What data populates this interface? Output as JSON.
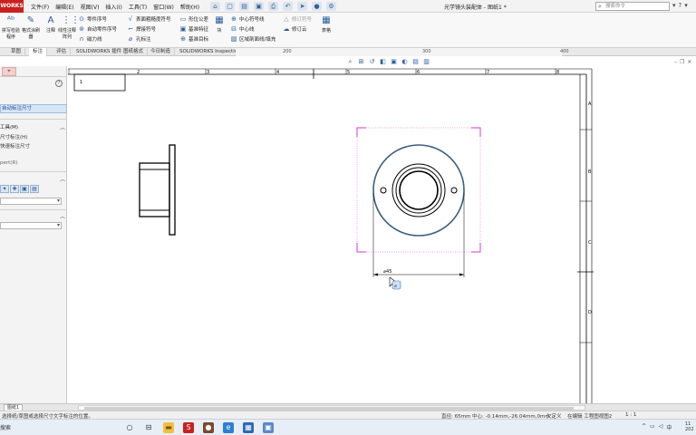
{
  "app": {
    "logo": "WORKS",
    "title": "光学镜头装配体 - 图纸1 *",
    "search_placeholder": "搜索命令"
  },
  "menus": [
    "文件(F)",
    "编辑(E)",
    "视图(V)",
    "插入(I)",
    "工具(T)",
    "窗口(W)",
    "帮助(H)"
  ],
  "ribbon": {
    "big_buttons": [
      {
        "label": "拼写检验程序",
        "icon": "abc-icon"
      },
      {
        "label": "格式涂刷器",
        "icon": "brush-icon"
      },
      {
        "label": "注释",
        "icon": "note-icon"
      },
      {
        "label": "线性注释阵列",
        "icon": "pattern-icon"
      }
    ],
    "col1": [
      "零件序号",
      "自动零件序号",
      "磁力线"
    ],
    "col2": [
      "表面粗糙度符号",
      "焊接符号",
      "孔标注"
    ],
    "col3": [
      "形位公差",
      "基准特征",
      "基准目标"
    ],
    "block_label": "块",
    "col4": [
      "中心符号线",
      "中心线",
      "区域剖面线/填充"
    ],
    "col5": [
      "修订符号",
      "修订云"
    ],
    "table_label": "表格"
  },
  "tabs": [
    "草图",
    "标注",
    "评估",
    "SOLIDWORKS 插件",
    "图纸格式",
    "今日制造",
    "SOLIDWORKS Inspection"
  ],
  "ruler": [
    "200",
    "300",
    "400"
  ],
  "sheet": {
    "cols": [
      "1",
      "2",
      "3",
      "4",
      "5",
      "6",
      "7",
      "8"
    ],
    "rows": [
      "A",
      "B",
      "C",
      "D"
    ],
    "title_cell": "1",
    "dimension_text": "⌀45"
  },
  "left_panel": {
    "selected_item": "自动标注尺寸",
    "section1_title": "工具(M)",
    "section1_items": [
      "尺寸标注(H)",
      "快速标注尺寸"
    ],
    "section1_extra": "pert(R)"
  },
  "sheet_tab": "图纸1",
  "status": {
    "message": "选择纸/草图或选择尺寸文字标注的位置。",
    "radius": "直径: 65mm",
    "center": "中心: -0.14mm,-26.04mm,0mm",
    "state": "欠定义",
    "edit": "在编辑 工程图视图2",
    "scale": "1 : 1"
  },
  "taskbar": {
    "search": "搜索",
    "ime": "中",
    "clock_time": "11",
    "clock_year": "202"
  },
  "colors": {
    "accent": "#c9211e",
    "select_magenta": "#d63ad6",
    "circle_blue": "#3a5f80"
  }
}
